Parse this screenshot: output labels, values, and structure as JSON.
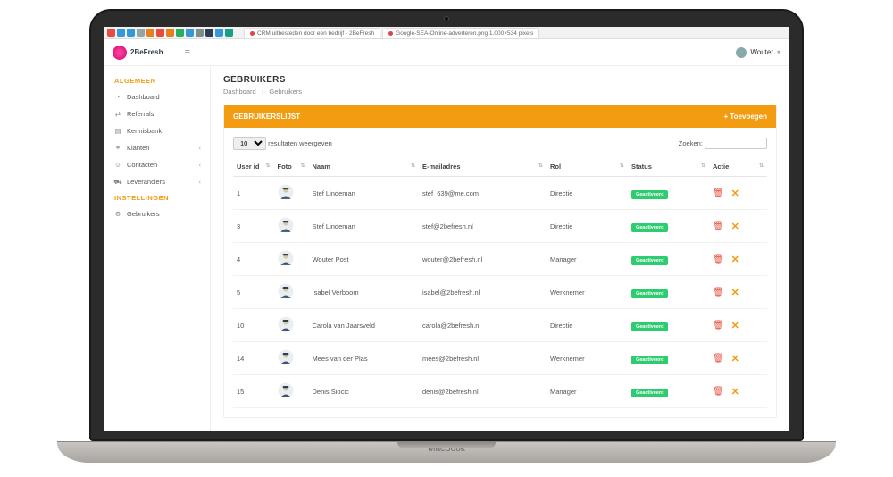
{
  "browser": {
    "tabs": [
      "CRM uitbesteden door een bedrijf - 2BeFresh",
      "Google-SEA-Online-adverteren.png 1.000×534 pixels"
    ]
  },
  "brand": "2BeFresh",
  "currentUser": "Wouter",
  "sidebar": {
    "heading_general": "ALGEMEEN",
    "heading_settings": "INSTELLINGEN",
    "items": [
      {
        "label": "Dashboard",
        "icon": "gauge"
      },
      {
        "label": "Referrals",
        "icon": "share"
      },
      {
        "label": "Kennisbank",
        "icon": "book"
      },
      {
        "label": "Klanten",
        "icon": "people",
        "caret": true
      },
      {
        "label": "Contacten",
        "icon": "person",
        "caret": true
      },
      {
        "label": "Leveranciers",
        "icon": "truck",
        "caret": true
      }
    ],
    "settings_items": [
      {
        "label": "Gebruikers",
        "icon": "gear"
      }
    ]
  },
  "page": {
    "title": "GEBRUIKERS",
    "crumb_root": "Dashboard",
    "crumb_leaf": "Gebruikers"
  },
  "panel": {
    "title": "GEBRUIKERSLIJST",
    "add": "+ Toevoegen"
  },
  "datatable": {
    "length_value": "10",
    "length_label": "resultaten weergeven",
    "search_label": "Zoeken:",
    "columns": [
      "User id",
      "Foto",
      "Naam",
      "E-mailadres",
      "Rol",
      "Status",
      "Actie"
    ],
    "status_badge": "Geactiveerd",
    "rows": [
      {
        "id": "1",
        "name": "Stef Lindeman",
        "email": "stef_639@me.com",
        "role": "Directie"
      },
      {
        "id": "3",
        "name": "Stef Lindeman",
        "email": "stef@2befresh.nl",
        "role": "Directie"
      },
      {
        "id": "4",
        "name": "Wouter Post",
        "email": "wouter@2befresh.nl",
        "role": "Manager"
      },
      {
        "id": "5",
        "name": "Isabel Verboom",
        "email": "isabel@2befresh.nl",
        "role": "Werknemer"
      },
      {
        "id": "10",
        "name": "Carola van Jaarsveld",
        "email": "carola@2befresh.nl",
        "role": "Directie"
      },
      {
        "id": "14",
        "name": "Mees van der Plas",
        "email": "mees@2befresh.nl",
        "role": "Werknemer"
      },
      {
        "id": "15",
        "name": "Denis Siocic",
        "email": "denis@2befresh.nl",
        "role": "Manager"
      }
    ]
  }
}
